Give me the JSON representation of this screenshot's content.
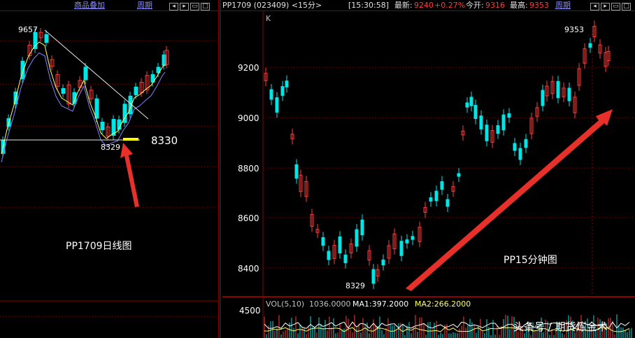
{
  "left_panel": {
    "toolbar": {
      "overlay_label": "商品叠加",
      "period_label": "周期"
    },
    "high_label": "9657",
    "low_label": "8329",
    "low_annotation": "8330",
    "chart_caption": "PP1709日线图"
  },
  "right_panel": {
    "header": {
      "symbol": "PP1709 (023409) <15分>",
      "time": "[15:30:58]",
      "latest_label": "最新:",
      "latest_value": "9240",
      "change_value": "+0.27%",
      "open_label": "今开:",
      "open_value": "9316",
      "high_label": "最高:",
      "high_value": "9353",
      "period_label": "周期"
    },
    "k_label": "K",
    "price_axis": [
      "9200",
      "9000",
      "8800",
      "8600",
      "8400"
    ],
    "high_label": "9353",
    "low_label": "8329",
    "chart_caption": "PP15分钟图",
    "volume": {
      "axis_label": "4500",
      "title": "VOL(5,10)",
      "value": "1036.0000",
      "ma1": "MA1:397.2000",
      "ma2": "MA2:266.2000"
    }
  },
  "watermark": "头条号 / 期货炼金术",
  "colors": {
    "up": "#ff3b3b",
    "down": "#00e5e5",
    "ma1": "#ffff66",
    "ma2": "#8080ff",
    "arrow": "#e8302a",
    "grid": "#8b0000"
  }
}
